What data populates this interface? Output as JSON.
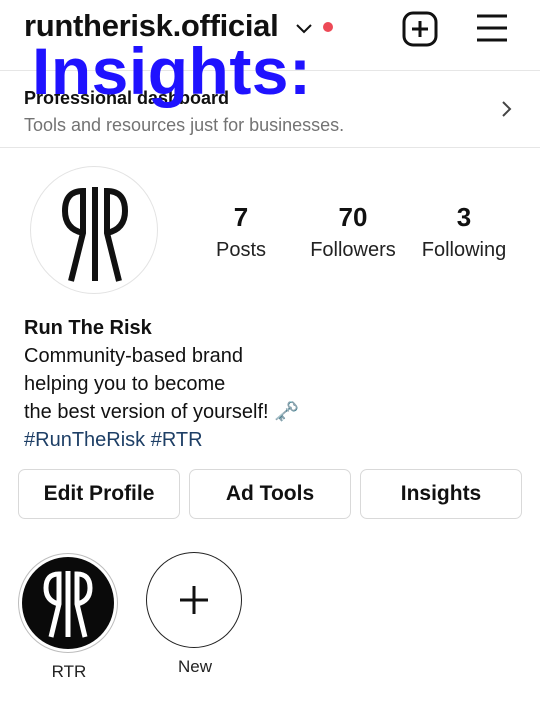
{
  "header": {
    "username": "runtherisk.official",
    "overlay_text": "Insights:"
  },
  "dashboard": {
    "title": "Professional dashboard",
    "subtitle": "Tools and resources just for businesses."
  },
  "profile": {
    "stats": [
      {
        "value": "7",
        "label": "Posts"
      },
      {
        "value": "70",
        "label": "Followers"
      },
      {
        "value": "3",
        "label": "Following"
      }
    ],
    "name": "Run The Risk",
    "bio_lines": [
      "Community-based brand",
      "helping you to become",
      "the best version of yourself! 🗝️"
    ],
    "hashtags": "#RunTheRisk #RTR"
  },
  "buttons": {
    "edit_profile": "Edit Profile",
    "ad_tools": "Ad Tools",
    "insights": "Insights"
  },
  "highlights": [
    {
      "label": "RTR"
    },
    {
      "label": "New"
    }
  ],
  "colors": {
    "overlay": "#1f12ff",
    "notification_dot": "#ed4956",
    "hashtag": "#1e3f66"
  }
}
